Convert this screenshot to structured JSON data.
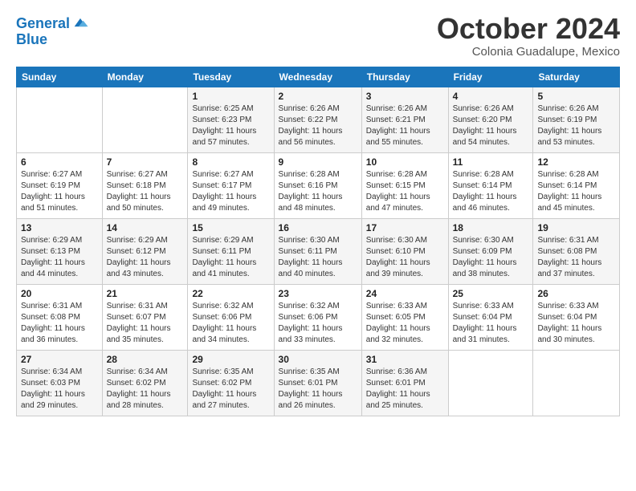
{
  "header": {
    "logo_line1": "General",
    "logo_line2": "Blue",
    "month": "October 2024",
    "location": "Colonia Guadalupe, Mexico"
  },
  "weekdays": [
    "Sunday",
    "Monday",
    "Tuesday",
    "Wednesday",
    "Thursday",
    "Friday",
    "Saturday"
  ],
  "weeks": [
    [
      {
        "day": "",
        "sunrise": "",
        "sunset": "",
        "daylight": ""
      },
      {
        "day": "",
        "sunrise": "",
        "sunset": "",
        "daylight": ""
      },
      {
        "day": "1",
        "sunrise": "Sunrise: 6:25 AM",
        "sunset": "Sunset: 6:23 PM",
        "daylight": "Daylight: 11 hours and 57 minutes."
      },
      {
        "day": "2",
        "sunrise": "Sunrise: 6:26 AM",
        "sunset": "Sunset: 6:22 PM",
        "daylight": "Daylight: 11 hours and 56 minutes."
      },
      {
        "day": "3",
        "sunrise": "Sunrise: 6:26 AM",
        "sunset": "Sunset: 6:21 PM",
        "daylight": "Daylight: 11 hours and 55 minutes."
      },
      {
        "day": "4",
        "sunrise": "Sunrise: 6:26 AM",
        "sunset": "Sunset: 6:20 PM",
        "daylight": "Daylight: 11 hours and 54 minutes."
      },
      {
        "day": "5",
        "sunrise": "Sunrise: 6:26 AM",
        "sunset": "Sunset: 6:19 PM",
        "daylight": "Daylight: 11 hours and 53 minutes."
      }
    ],
    [
      {
        "day": "6",
        "sunrise": "Sunrise: 6:27 AM",
        "sunset": "Sunset: 6:19 PM",
        "daylight": "Daylight: 11 hours and 51 minutes."
      },
      {
        "day": "7",
        "sunrise": "Sunrise: 6:27 AM",
        "sunset": "Sunset: 6:18 PM",
        "daylight": "Daylight: 11 hours and 50 minutes."
      },
      {
        "day": "8",
        "sunrise": "Sunrise: 6:27 AM",
        "sunset": "Sunset: 6:17 PM",
        "daylight": "Daylight: 11 hours and 49 minutes."
      },
      {
        "day": "9",
        "sunrise": "Sunrise: 6:28 AM",
        "sunset": "Sunset: 6:16 PM",
        "daylight": "Daylight: 11 hours and 48 minutes."
      },
      {
        "day": "10",
        "sunrise": "Sunrise: 6:28 AM",
        "sunset": "Sunset: 6:15 PM",
        "daylight": "Daylight: 11 hours and 47 minutes."
      },
      {
        "day": "11",
        "sunrise": "Sunrise: 6:28 AM",
        "sunset": "Sunset: 6:14 PM",
        "daylight": "Daylight: 11 hours and 46 minutes."
      },
      {
        "day": "12",
        "sunrise": "Sunrise: 6:28 AM",
        "sunset": "Sunset: 6:14 PM",
        "daylight": "Daylight: 11 hours and 45 minutes."
      }
    ],
    [
      {
        "day": "13",
        "sunrise": "Sunrise: 6:29 AM",
        "sunset": "Sunset: 6:13 PM",
        "daylight": "Daylight: 11 hours and 44 minutes."
      },
      {
        "day": "14",
        "sunrise": "Sunrise: 6:29 AM",
        "sunset": "Sunset: 6:12 PM",
        "daylight": "Daylight: 11 hours and 43 minutes."
      },
      {
        "day": "15",
        "sunrise": "Sunrise: 6:29 AM",
        "sunset": "Sunset: 6:11 PM",
        "daylight": "Daylight: 11 hours and 41 minutes."
      },
      {
        "day": "16",
        "sunrise": "Sunrise: 6:30 AM",
        "sunset": "Sunset: 6:11 PM",
        "daylight": "Daylight: 11 hours and 40 minutes."
      },
      {
        "day": "17",
        "sunrise": "Sunrise: 6:30 AM",
        "sunset": "Sunset: 6:10 PM",
        "daylight": "Daylight: 11 hours and 39 minutes."
      },
      {
        "day": "18",
        "sunrise": "Sunrise: 6:30 AM",
        "sunset": "Sunset: 6:09 PM",
        "daylight": "Daylight: 11 hours and 38 minutes."
      },
      {
        "day": "19",
        "sunrise": "Sunrise: 6:31 AM",
        "sunset": "Sunset: 6:08 PM",
        "daylight": "Daylight: 11 hours and 37 minutes."
      }
    ],
    [
      {
        "day": "20",
        "sunrise": "Sunrise: 6:31 AM",
        "sunset": "Sunset: 6:08 PM",
        "daylight": "Daylight: 11 hours and 36 minutes."
      },
      {
        "day": "21",
        "sunrise": "Sunrise: 6:31 AM",
        "sunset": "Sunset: 6:07 PM",
        "daylight": "Daylight: 11 hours and 35 minutes."
      },
      {
        "day": "22",
        "sunrise": "Sunrise: 6:32 AM",
        "sunset": "Sunset: 6:06 PM",
        "daylight": "Daylight: 11 hours and 34 minutes."
      },
      {
        "day": "23",
        "sunrise": "Sunrise: 6:32 AM",
        "sunset": "Sunset: 6:06 PM",
        "daylight": "Daylight: 11 hours and 33 minutes."
      },
      {
        "day": "24",
        "sunrise": "Sunrise: 6:33 AM",
        "sunset": "Sunset: 6:05 PM",
        "daylight": "Daylight: 11 hours and 32 minutes."
      },
      {
        "day": "25",
        "sunrise": "Sunrise: 6:33 AM",
        "sunset": "Sunset: 6:04 PM",
        "daylight": "Daylight: 11 hours and 31 minutes."
      },
      {
        "day": "26",
        "sunrise": "Sunrise: 6:33 AM",
        "sunset": "Sunset: 6:04 PM",
        "daylight": "Daylight: 11 hours and 30 minutes."
      }
    ],
    [
      {
        "day": "27",
        "sunrise": "Sunrise: 6:34 AM",
        "sunset": "Sunset: 6:03 PM",
        "daylight": "Daylight: 11 hours and 29 minutes."
      },
      {
        "day": "28",
        "sunrise": "Sunrise: 6:34 AM",
        "sunset": "Sunset: 6:02 PM",
        "daylight": "Daylight: 11 hours and 28 minutes."
      },
      {
        "day": "29",
        "sunrise": "Sunrise: 6:35 AM",
        "sunset": "Sunset: 6:02 PM",
        "daylight": "Daylight: 11 hours and 27 minutes."
      },
      {
        "day": "30",
        "sunrise": "Sunrise: 6:35 AM",
        "sunset": "Sunset: 6:01 PM",
        "daylight": "Daylight: 11 hours and 26 minutes."
      },
      {
        "day": "31",
        "sunrise": "Sunrise: 6:36 AM",
        "sunset": "Sunset: 6:01 PM",
        "daylight": "Daylight: 11 hours and 25 minutes."
      },
      {
        "day": "",
        "sunrise": "",
        "sunset": "",
        "daylight": ""
      },
      {
        "day": "",
        "sunrise": "",
        "sunset": "",
        "daylight": ""
      }
    ]
  ]
}
